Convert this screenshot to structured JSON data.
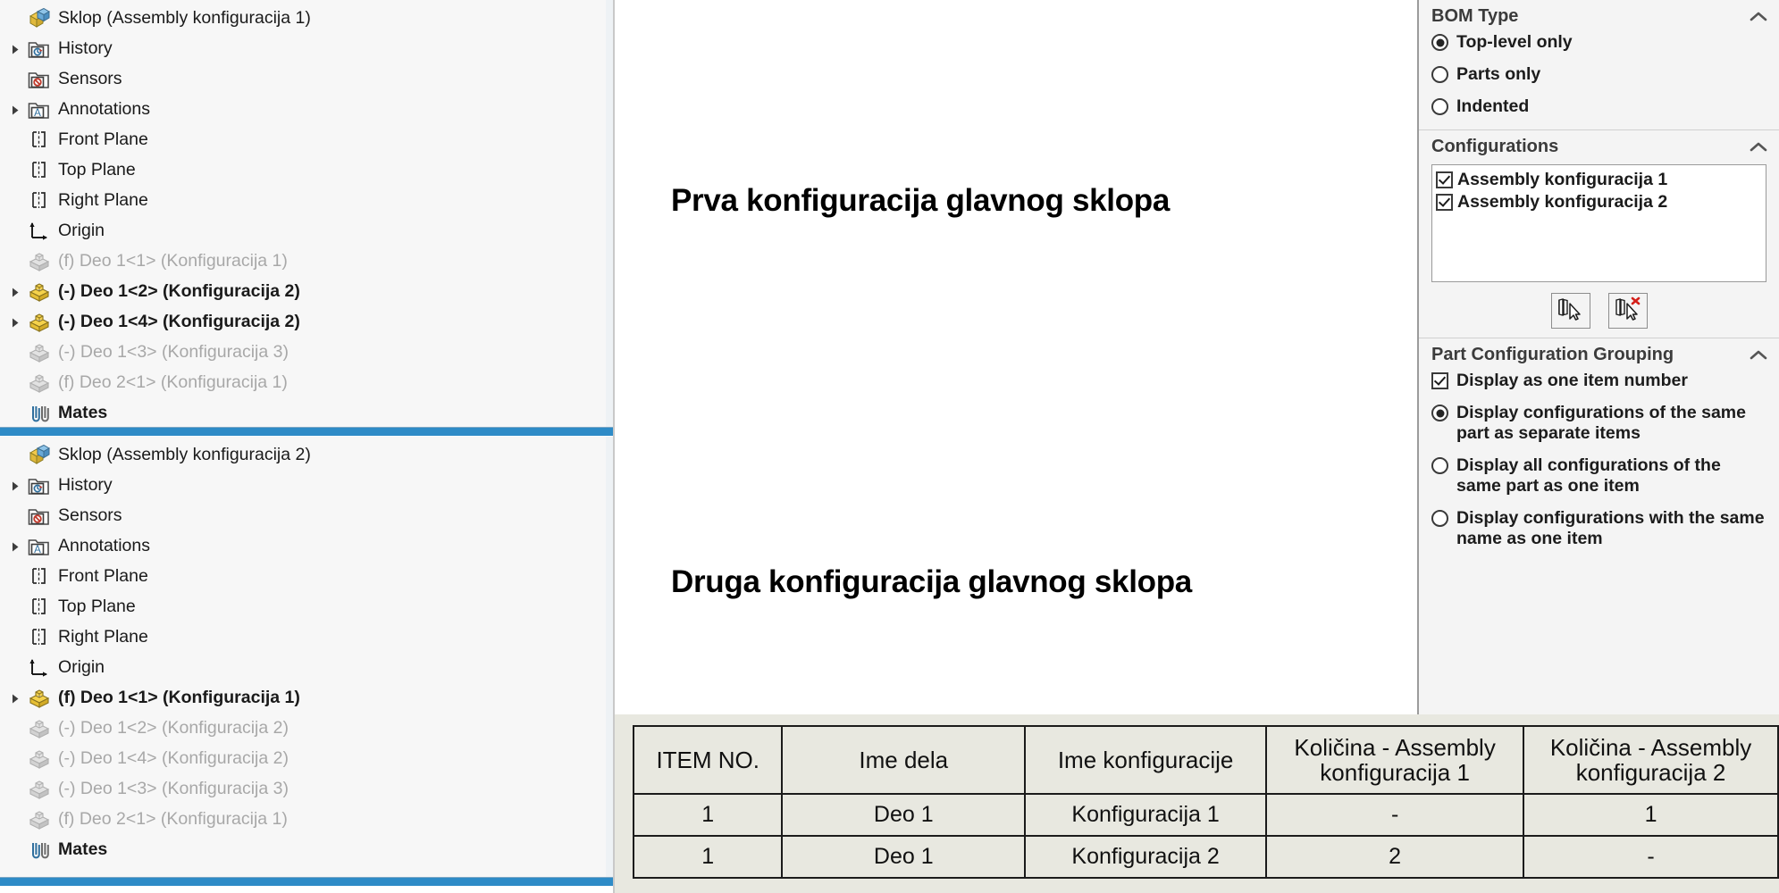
{
  "trees": [
    {
      "root": {
        "label": "Sklop  (Assembly konfiguracija 1)",
        "icon": "assembly-icon"
      },
      "items": [
        {
          "label": "History",
          "icon": "history-folder-icon",
          "arrow": true,
          "dim": false,
          "bold": false
        },
        {
          "label": "Sensors",
          "icon": "sensors-folder-icon",
          "arrow": false,
          "dim": false,
          "bold": false
        },
        {
          "label": "Annotations",
          "icon": "annotations-folder-icon",
          "arrow": true,
          "dim": false,
          "bold": false
        },
        {
          "label": "Front Plane",
          "icon": "plane-icon",
          "arrow": false,
          "dim": false,
          "bold": false
        },
        {
          "label": "Top Plane",
          "icon": "plane-icon",
          "arrow": false,
          "dim": false,
          "bold": false
        },
        {
          "label": "Right Plane",
          "icon": "plane-icon",
          "arrow": false,
          "dim": false,
          "bold": false
        },
        {
          "label": "Origin",
          "icon": "origin-icon",
          "arrow": false,
          "dim": false,
          "bold": false
        },
        {
          "label": "(f) Deo 1<1> (Konfiguracija 1)",
          "icon": "part-icon-gray",
          "arrow": false,
          "dim": true,
          "bold": false
        },
        {
          "label": "(-) Deo 1<2> (Konfiguracija 2)",
          "icon": "part-icon-yellow",
          "arrow": true,
          "dim": false,
          "bold": true
        },
        {
          "label": "(-) Deo 1<4> (Konfiguracija 2)",
          "icon": "part-icon-yellow",
          "arrow": true,
          "dim": false,
          "bold": true
        },
        {
          "label": "(-) Deo 1<3> (Konfiguracija 3)",
          "icon": "part-icon-gray",
          "arrow": false,
          "dim": true,
          "bold": false
        },
        {
          "label": "(f) Deo 2<1> (Konfiguracija 1)",
          "icon": "part-icon-gray",
          "arrow": false,
          "dim": true,
          "bold": false
        },
        {
          "label": "Mates",
          "icon": "mates-icon",
          "arrow": false,
          "dim": false,
          "bold": true
        }
      ]
    },
    {
      "root": {
        "label": "Sklop  (Assembly konfiguracija 2)",
        "icon": "assembly-icon"
      },
      "items": [
        {
          "label": "History",
          "icon": "history-folder-icon",
          "arrow": true,
          "dim": false,
          "bold": false
        },
        {
          "label": "Sensors",
          "icon": "sensors-folder-icon",
          "arrow": false,
          "dim": false,
          "bold": false
        },
        {
          "label": "Annotations",
          "icon": "annotations-folder-icon",
          "arrow": true,
          "dim": false,
          "bold": false
        },
        {
          "label": "Front Plane",
          "icon": "plane-icon",
          "arrow": false,
          "dim": false,
          "bold": false
        },
        {
          "label": "Top Plane",
          "icon": "plane-icon",
          "arrow": false,
          "dim": false,
          "bold": false
        },
        {
          "label": "Right Plane",
          "icon": "plane-icon",
          "arrow": false,
          "dim": false,
          "bold": false
        },
        {
          "label": "Origin",
          "icon": "origin-icon",
          "arrow": false,
          "dim": false,
          "bold": false
        },
        {
          "label": "(f) Deo 1<1> (Konfiguracija 1)",
          "icon": "part-icon-yellow",
          "arrow": true,
          "dim": false,
          "bold": true
        },
        {
          "label": "(-) Deo 1<2> (Konfiguracija 2)",
          "icon": "part-icon-gray",
          "arrow": false,
          "dim": true,
          "bold": false
        },
        {
          "label": "(-) Deo 1<4> (Konfiguracija 2)",
          "icon": "part-icon-gray",
          "arrow": false,
          "dim": true,
          "bold": false
        },
        {
          "label": "(-) Deo 1<3> (Konfiguracija 3)",
          "icon": "part-icon-gray",
          "arrow": false,
          "dim": true,
          "bold": false
        },
        {
          "label": "(f) Deo 2<1> (Konfiguracija 1)",
          "icon": "part-icon-gray",
          "arrow": false,
          "dim": true,
          "bold": false
        },
        {
          "label": "Mates",
          "icon": "mates-icon",
          "arrow": false,
          "dim": false,
          "bold": true
        }
      ]
    }
  ],
  "graphics": {
    "title_1": "Prva konfiguracija glavnog sklopa",
    "title_2": "Druga konfiguracija glavnog sklopa"
  },
  "property_panel": {
    "bom_type": {
      "header": "BOM Type",
      "collapse_icon": "chevron-up-icon",
      "options": [
        {
          "label": "Top-level only",
          "selected": true
        },
        {
          "label": "Parts only",
          "selected": false
        },
        {
          "label": "Indented",
          "selected": false
        }
      ]
    },
    "configurations": {
      "header": "Configurations",
      "collapse_icon": "chevron-up-icon",
      "items": [
        {
          "label": "Assembly konfiguracija 1",
          "checked": true
        },
        {
          "label": "Assembly konfiguracija 2",
          "checked": true
        }
      ],
      "buttons": [
        {
          "name": "select-all-configurations-button",
          "icon": "select-configurations-icon"
        },
        {
          "name": "clear-all-configurations-button",
          "icon": "clear-configurations-icon"
        }
      ]
    },
    "part_configuration_grouping": {
      "header": "Part Configuration Grouping",
      "collapse_icon": "chevron-up-icon",
      "checkbox": {
        "label": "Display as one item number",
        "checked": true
      },
      "options": [
        {
          "label": "Display configurations of the same part as separate items",
          "selected": true
        },
        {
          "label": "Display all configurations of the same part as one item",
          "selected": false
        },
        {
          "label": "Display configurations with the same name as one item",
          "selected": false
        }
      ]
    }
  },
  "bom_table": {
    "headers": [
      "ITEM NO.",
      "Ime dela",
      "Ime konfiguracije",
      "Količina - Assembly konfiguracija 1",
      "Količina - Assembly konfiguracija 2"
    ],
    "rows": [
      [
        "1",
        "Deo 1",
        "Konfiguracija 1",
        "-",
        "1"
      ],
      [
        "1",
        "Deo 1",
        "Konfiguracija 2",
        "2",
        "-"
      ]
    ]
  },
  "colors": {
    "splitter_blue": "#2e8bc7",
    "part_yellow": "#f5cd3a",
    "part_gray": "#c6c6c6",
    "table_bg": "#e8e8e0",
    "panel_bg": "#f4f4f4",
    "tree_bg": "#f7f7f7"
  }
}
